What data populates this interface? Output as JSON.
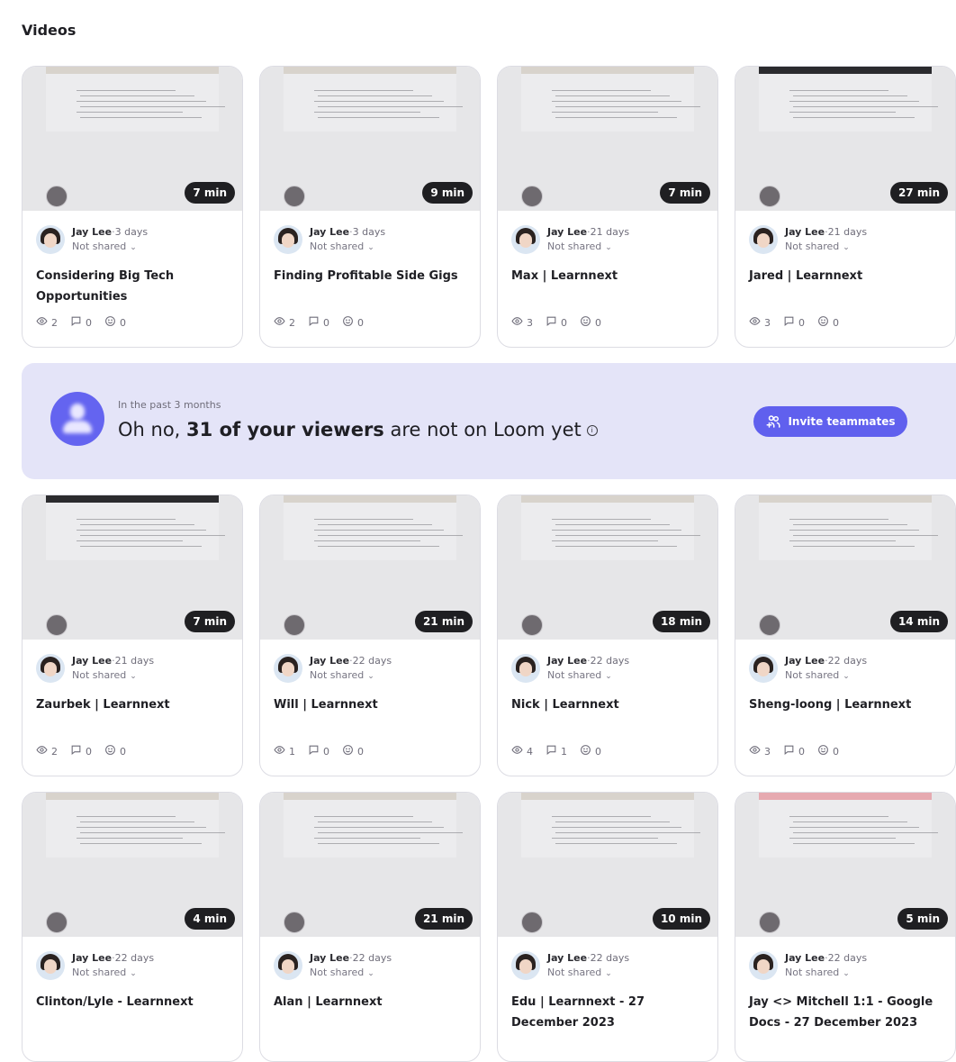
{
  "section_title": "Videos",
  "banner": {
    "subtitle": "In the past 3 months",
    "message_prefix": "Oh no, ",
    "message_bold": "31 of your viewers",
    "message_suffix": " are not on Loom yet",
    "info_icon": "info-icon",
    "button_label": "Invite teammates",
    "accent_color": "#6060ee"
  },
  "share_label": "Not shared",
  "videos": [
    {
      "author": "Jay Lee",
      "ago": "3 days",
      "title": "Considering Big Tech Opportunities",
      "duration": "7 min",
      "views": "2",
      "comments": "0",
      "reactions": "0",
      "bar": "tan"
    },
    {
      "author": "Jay Lee",
      "ago": "3 days",
      "title": "Finding Profitable Side Gigs",
      "duration": "9 min",
      "views": "2",
      "comments": "0",
      "reactions": "0",
      "bar": "tan"
    },
    {
      "author": "Jay Lee",
      "ago": "21 days",
      "title": "Max | Learnnext",
      "duration": "7 min",
      "views": "3",
      "comments": "0",
      "reactions": "0",
      "bar": "light"
    },
    {
      "author": "Jay Lee",
      "ago": "21 days",
      "title": "Jared | Learnnext",
      "duration": "27 min",
      "views": "3",
      "comments": "0",
      "reactions": "0",
      "bar": "dark"
    },
    {
      "author": "Jay Lee",
      "ago": "21 days",
      "title": "Zaurbek | Learnnext",
      "duration": "7 min",
      "views": "2",
      "comments": "0",
      "reactions": "0",
      "bar": "dark"
    },
    {
      "author": "Jay Lee",
      "ago": "22 days",
      "title": "Will | Learnnext",
      "duration": "21 min",
      "views": "1",
      "comments": "0",
      "reactions": "0",
      "bar": "light"
    },
    {
      "author": "Jay Lee",
      "ago": "22 days",
      "title": "Nick | Learnnext",
      "duration": "18 min",
      "views": "4",
      "comments": "1",
      "reactions": "0",
      "bar": "light"
    },
    {
      "author": "Jay Lee",
      "ago": "22 days",
      "title": "Sheng-loong | Learnnext",
      "duration": "14 min",
      "views": "3",
      "comments": "0",
      "reactions": "0",
      "bar": "light"
    },
    {
      "author": "Jay Lee",
      "ago": "22 days",
      "title": "Clinton/Lyle - Learnnext",
      "duration": "4 min",
      "views": "",
      "comments": "",
      "reactions": "",
      "bar": "light"
    },
    {
      "author": "Jay Lee",
      "ago": "22 days",
      "title": "Alan | Learnnext",
      "duration": "21 min",
      "views": "",
      "comments": "",
      "reactions": "",
      "bar": "light"
    },
    {
      "author": "Jay Lee",
      "ago": "22 days",
      "title": "Edu | Learnnext - 27 December 2023",
      "duration": "10 min",
      "views": "",
      "comments": "",
      "reactions": "",
      "bar": "light"
    },
    {
      "author": "Jay Lee",
      "ago": "22 days",
      "title": "Jay <> Mitchell 1:1 - Google Docs - 27 December 2023",
      "duration": "5 min",
      "views": "",
      "comments": "",
      "reactions": "",
      "bar": "pink"
    }
  ]
}
